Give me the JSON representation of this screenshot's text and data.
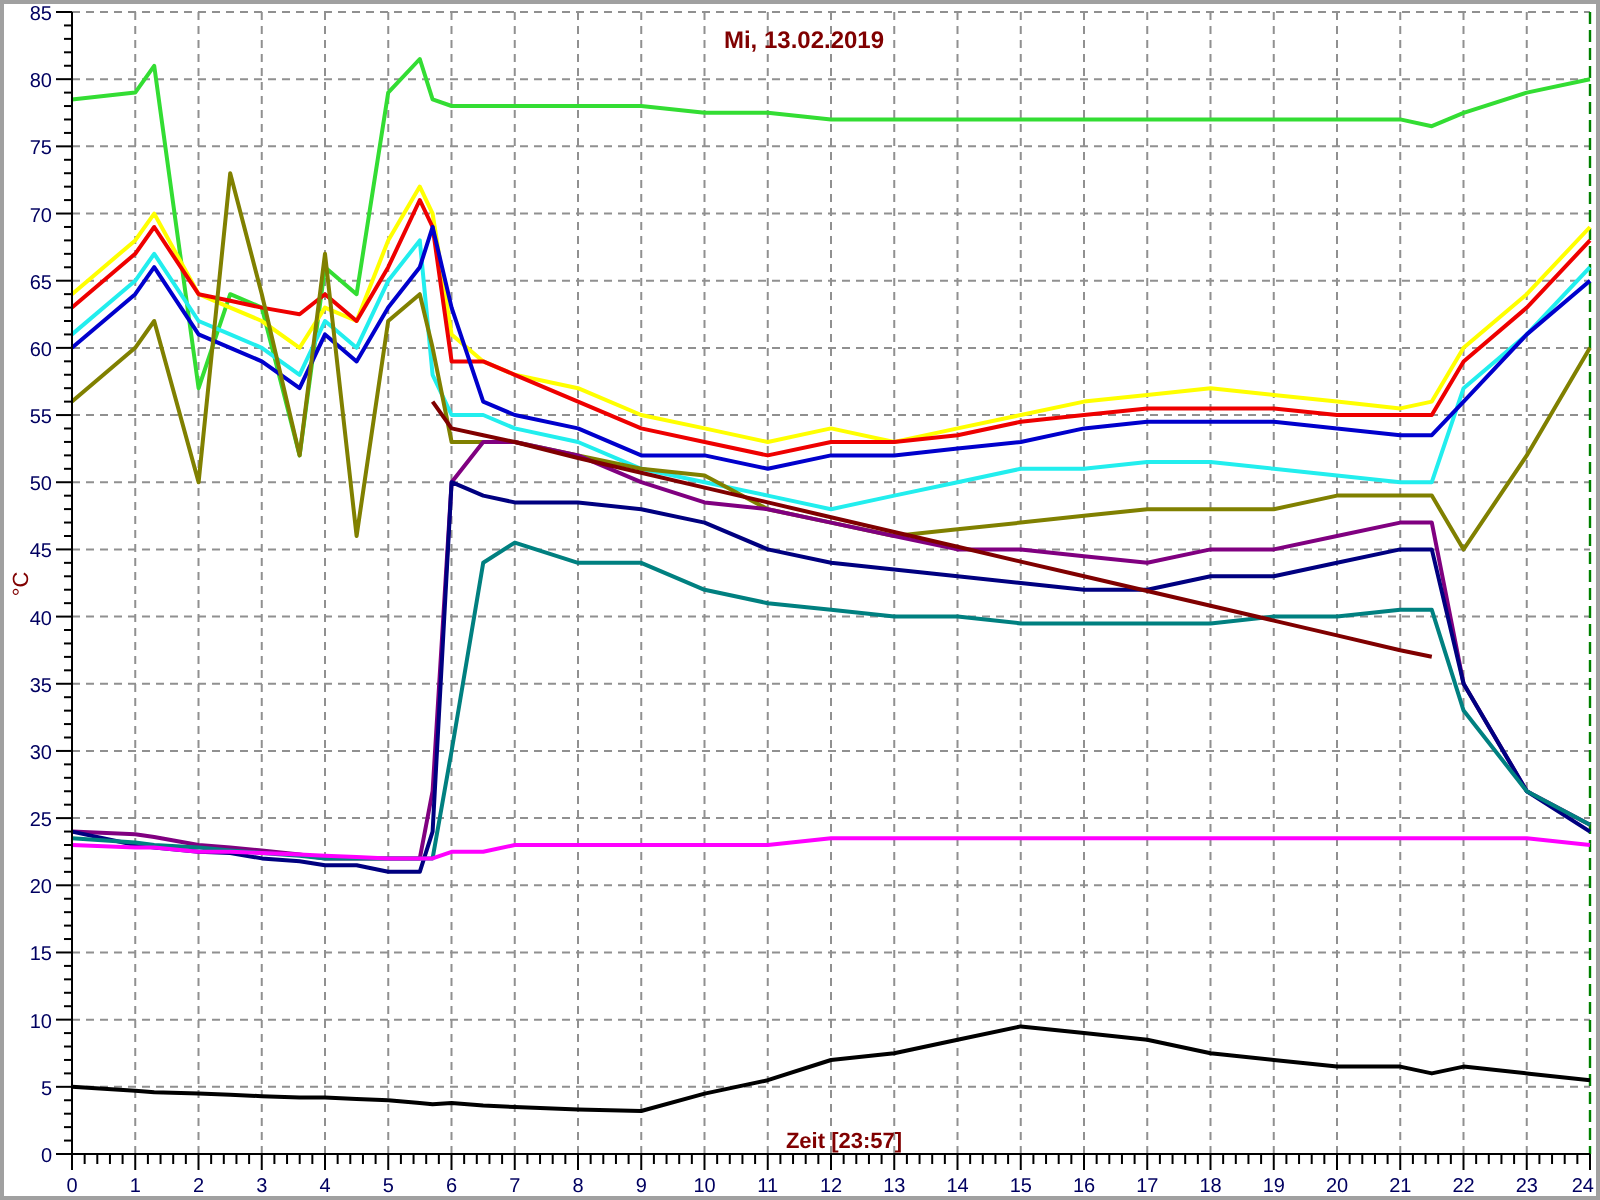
{
  "chart": {
    "chart_data": {
      "type": "line",
      "title": "Mi, 13.02.2019",
      "xlabel": "Zeit [23:57]",
      "ylabel": "°C",
      "x": [
        0,
        1,
        1.3,
        2,
        2.5,
        3,
        3.6,
        4,
        4.5,
        5,
        5.5,
        5.7,
        6,
        6.5,
        7,
        8,
        9,
        10,
        11,
        12,
        13,
        14,
        15,
        16,
        17,
        18,
        19,
        20,
        21,
        21.5,
        22,
        23,
        24
      ],
      "series": [
        {
          "color": "#33dd33",
          "values": [
            78.5,
            79,
            81,
            57,
            64,
            63,
            52,
            66,
            64,
            79,
            81.5,
            78.5,
            78,
            78,
            78,
            78,
            78,
            77.5,
            77.5,
            77,
            77,
            77,
            77,
            77,
            77,
            77,
            77,
            77,
            77,
            76.5,
            77.5,
            79,
            80
          ]
        },
        {
          "color": "#ffff00",
          "values": [
            64,
            68,
            70,
            64,
            63,
            62,
            60,
            63,
            62,
            68,
            72,
            70,
            61,
            59,
            58,
            57,
            55,
            54,
            53,
            54,
            53,
            54,
            55,
            56,
            56.5,
            57,
            56.5,
            56,
            55.5,
            56,
            60,
            64,
            69
          ]
        },
        {
          "color": "#ee0000",
          "values": [
            63,
            67,
            69,
            64,
            63.5,
            63,
            62.5,
            64,
            62,
            66,
            71,
            69,
            59,
            59,
            58,
            56,
            54,
            53,
            52,
            53,
            53,
            53.5,
            54.5,
            55,
            55.5,
            55.5,
            55.5,
            55,
            55,
            55,
            59,
            63,
            68
          ]
        },
        {
          "color": "#22eeee",
          "values": [
            61,
            65,
            67,
            62,
            61,
            60,
            58,
            62,
            60,
            65,
            68,
            58,
            55,
            55,
            54,
            53,
            51,
            50,
            49,
            48,
            49,
            50,
            51,
            51,
            51.5,
            51.5,
            51,
            50.5,
            50,
            50,
            57,
            61,
            66
          ]
        },
        {
          "color": "#0000cc",
          "values": [
            60,
            64,
            66,
            61,
            60,
            59,
            57,
            61,
            59,
            63,
            66,
            69,
            63,
            56,
            55,
            54,
            52,
            52,
            51,
            52,
            52,
            52.5,
            53,
            54,
            54.5,
            54.5,
            54.5,
            54,
            53.5,
            53.5,
            56,
            61,
            65
          ]
        },
        {
          "color": "#808000",
          "values": [
            56,
            60,
            62,
            50,
            73,
            64,
            52,
            67,
            46,
            62,
            64,
            60,
            53,
            53,
            53,
            52,
            51,
            50.5,
            48,
            47,
            46,
            46.5,
            47,
            47.5,
            48,
            48,
            48,
            49,
            49,
            49,
            45,
            52,
            60
          ]
        },
        {
          "color": "#800080",
          "values": [
            24,
            23.8,
            23.6,
            23,
            22.8,
            22.6,
            22.3,
            22,
            22,
            22,
            22,
            27,
            50,
            53,
            53,
            52,
            50,
            48.5,
            48,
            47,
            46,
            45,
            45,
            44.5,
            44,
            45,
            45,
            46,
            47,
            47,
            35,
            27,
            24.5
          ]
        },
        {
          "color": "#000080",
          "values": [
            24,
            23,
            22.8,
            22.5,
            22.4,
            22,
            21.8,
            21.5,
            21.5,
            21,
            21,
            24,
            50,
            49,
            48.5,
            48.5,
            48,
            47,
            45,
            44,
            43.5,
            43,
            42.5,
            42,
            42,
            43,
            43,
            44,
            45,
            45,
            35,
            27,
            24
          ]
        },
        {
          "color": "#008080",
          "values": [
            23.5,
            23.2,
            23,
            22.8,
            22.6,
            22.4,
            22.2,
            22,
            22,
            22,
            22,
            22,
            30,
            44,
            45.5,
            44,
            44,
            42,
            41,
            40.5,
            40,
            40,
            39.5,
            39.5,
            39.5,
            39.5,
            40,
            40,
            40.5,
            40.5,
            33,
            27,
            24.5
          ]
        },
        {
          "color": "#ff00ff",
          "values": [
            23,
            22.8,
            22.8,
            22.5,
            22.5,
            22.4,
            22.3,
            22.2,
            22.1,
            22,
            22,
            22,
            22.5,
            22.5,
            23,
            23,
            23,
            23,
            23,
            23.5,
            23.5,
            23.5,
            23.5,
            23.5,
            23.5,
            23.5,
            23.5,
            23.5,
            23.5,
            23.5,
            23.5,
            23.5,
            23
          ]
        },
        {
          "color": "#800000",
          "values": [
            null,
            null,
            null,
            null,
            null,
            null,
            null,
            null,
            null,
            null,
            null,
            56,
            54,
            53.5,
            53,
            51.8,
            50.7,
            49.6,
            48.5,
            47.4,
            46.3,
            45.2,
            44.1,
            43,
            41.9,
            40.8,
            39.7,
            38.6,
            37.5,
            37,
            null,
            null,
            null
          ]
        },
        {
          "color": "#000000",
          "values": [
            5,
            4.7,
            4.6,
            4.5,
            4.4,
            4.3,
            4.2,
            4.2,
            4.1,
            4,
            3.8,
            3.7,
            3.8,
            3.6,
            3.5,
            3.3,
            3.2,
            4.5,
            5.5,
            7,
            7.5,
            8.5,
            9.5,
            9,
            8.5,
            7.5,
            7,
            6.5,
            6.5,
            6,
            6.5,
            6,
            5.5
          ]
        }
      ],
      "grid": true,
      "xlim": [
        0,
        24
      ],
      "ylim": [
        0,
        85
      ],
      "xticks": [
        0,
        1,
        2,
        3,
        4,
        5,
        6,
        7,
        8,
        9,
        10,
        11,
        12,
        13,
        14,
        15,
        16,
        17,
        18,
        19,
        20,
        21,
        22,
        23,
        24
      ],
      "yticks": [
        0,
        5,
        10,
        15,
        20,
        25,
        30,
        35,
        40,
        45,
        50,
        55,
        60,
        65,
        70,
        75,
        80,
        85
      ]
    }
  }
}
